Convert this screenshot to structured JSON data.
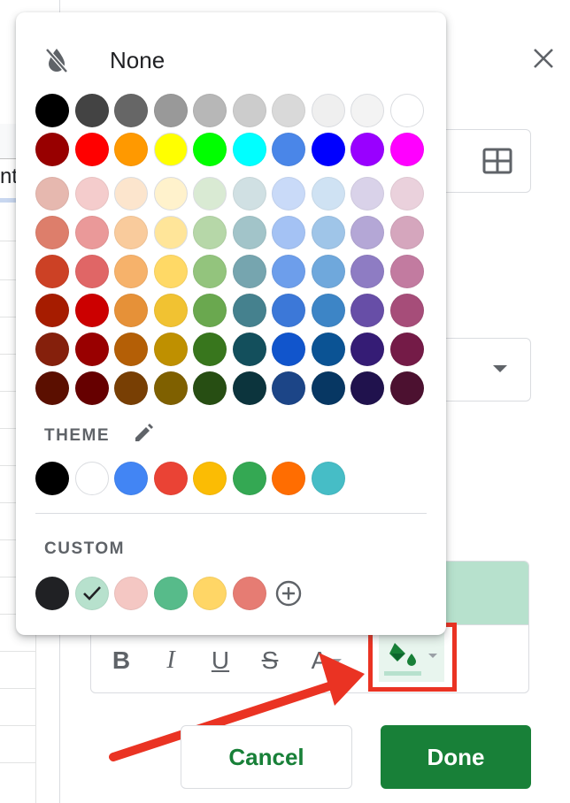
{
  "sheet": {
    "fragment": "nt"
  },
  "picker": {
    "none_label": "None",
    "none_icon": "format-color-reset-icon",
    "standard_rows": [
      [
        "#000000",
        "#434343",
        "#666666",
        "#999999",
        "#b7b7b7",
        "#cccccc",
        "#d9d9d9",
        "#efefef",
        "#f3f3f3",
        "#ffffff"
      ],
      [
        "#980000",
        "#ff0000",
        "#ff9900",
        "#ffff00",
        "#00ff00",
        "#00ffff",
        "#4a86e8",
        "#0000ff",
        "#9900ff",
        "#ff00ff"
      ],
      [
        "#e6b8af",
        "#f4cccc",
        "#fce5cd",
        "#fff2cc",
        "#d9ead3",
        "#d0e0e3",
        "#c9daf8",
        "#cfe2f3",
        "#d9d2e9",
        "#ead1dc"
      ],
      [
        "#dd7e6b",
        "#ea9999",
        "#f9cb9c",
        "#ffe599",
        "#b6d7a8",
        "#a2c4c9",
        "#a4c2f4",
        "#9fc5e8",
        "#b4a7d6",
        "#d5a6bd"
      ],
      [
        "#cc4125",
        "#e06666",
        "#f6b26b",
        "#ffd966",
        "#93c47d",
        "#76a5af",
        "#6d9eeb",
        "#6fa8dc",
        "#8e7cc3",
        "#c27ba0"
      ],
      [
        "#a61c00",
        "#cc0000",
        "#e69138",
        "#f1c232",
        "#6aa84f",
        "#45818e",
        "#3c78d8",
        "#3d85c6",
        "#674ea7",
        "#a64d79"
      ],
      [
        "#85200c",
        "#990000",
        "#b45f06",
        "#bf9000",
        "#38761d",
        "#134f5c",
        "#1155cc",
        "#0b5394",
        "#351c75",
        "#741b47"
      ],
      [
        "#5b0f00",
        "#660000",
        "#783f04",
        "#7f6000",
        "#274e13",
        "#0c343d",
        "#1c4587",
        "#073763",
        "#20124d",
        "#4c1130"
      ]
    ],
    "theme_label": "THEME",
    "theme_edit_icon": "pencil-icon",
    "theme_colors": [
      "#000000",
      "#ffffff",
      "#4285f4",
      "#ea4335",
      "#fbbc04",
      "#34a853",
      "#ff6d01",
      "#46bdc6"
    ],
    "custom_label": "CUSTOM",
    "custom_colors": [
      "#202124",
      "#b7e1cd",
      "#f4c7c3",
      "#57bb8a",
      "#ffd666",
      "#e67c73"
    ],
    "custom_selected_index": 1,
    "add_custom_icon": "add-circle-icon"
  },
  "panel": {
    "close_icon": "close-icon",
    "range_icon": "grid-icon",
    "formatting": {
      "bold_label": "B",
      "italic_label": "I",
      "underline_label": "U",
      "strike_label": "S",
      "text_color_label": "A",
      "fill_icon": "fill-color-icon",
      "fill_color": "#b7e1cd"
    }
  },
  "actions": {
    "cancel_label": "Cancel",
    "done_label": "Done"
  },
  "colors": {
    "accent_green": "#188038",
    "highlight_red": "#ea3323"
  }
}
